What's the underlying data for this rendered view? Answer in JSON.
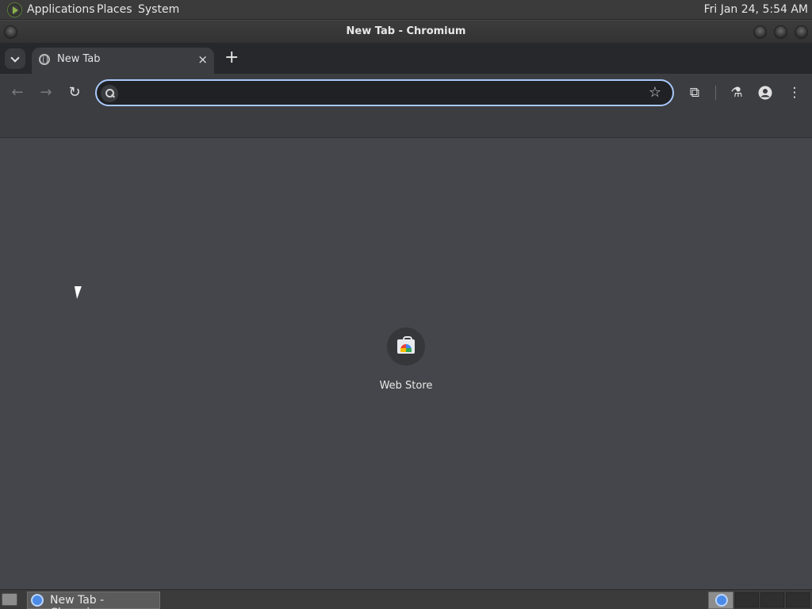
{
  "top_panel": {
    "menus": [
      "Applications",
      "Places",
      "System"
    ],
    "clock": "Fri Jan 24,  5:54 AM"
  },
  "window": {
    "title": "New Tab - Chromium"
  },
  "tabs": [
    {
      "title": "New Tab",
      "close": "×"
    }
  ],
  "new_tab_symbol": "+",
  "toolbar": {
    "back": "←",
    "forward": "→",
    "reload": "↻",
    "omnibox_value": "",
    "star": "☆",
    "extensions": "⧉",
    "labs": "⚗",
    "menu": "⋮"
  },
  "content": {
    "shortcut_label": "Web Store"
  },
  "taskbar": {
    "task_label": "New Tab - Chromium"
  }
}
